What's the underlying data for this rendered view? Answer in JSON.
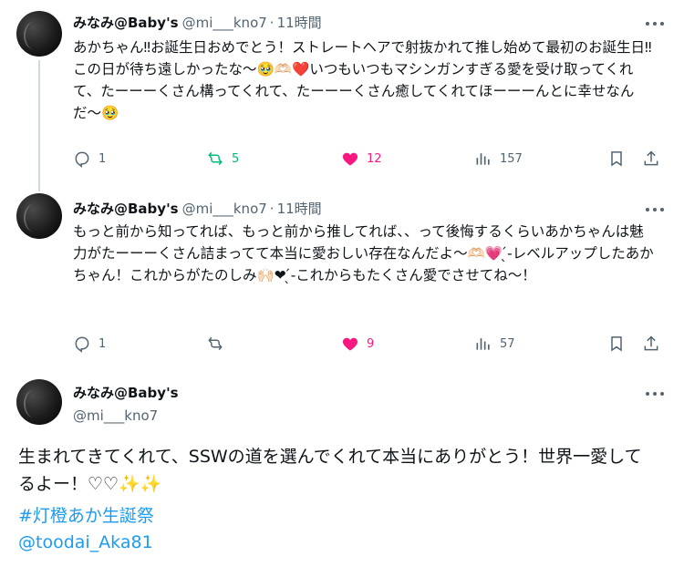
{
  "tweets": [
    {
      "name": "みなみ@Baby's",
      "handle": "@mi___kno7",
      "separator": "·",
      "time": "11時間",
      "text": "あかちゃん‼お誕生日おめでとう！ストレートヘアで射抜かれて推し始めて最初のお誕生日‼この日が待ち遠しかったな〜🥹🫶🏻❤️いつもいつもマシンガンすぎる愛を受け取ってくれて、たーーーくさん構ってくれて、たーーーくさん癒してくれてほーーーんとに幸せなんだ〜🥹",
      "replies": "1",
      "reposts": "5",
      "likes": "12",
      "views": "157"
    },
    {
      "name": "みなみ@Baby's",
      "handle": "@mi___kno7",
      "separator": "·",
      "time": "11時間",
      "text": "もっと前から知ってれば、もっと前から推してれば、、って後悔するくらいあかちゃんは魅力がたーーーくさん詰まってて本当に愛おしい存在なんだよ〜🫶🏻💗 ̖́-レベルアップしたあかちゃん！これからがたのしみ🙌🏻❤︎ ̖́-これからもたくさん愛でさせてね〜！",
      "replies": "1",
      "reposts": "",
      "likes": "9",
      "views": "57"
    }
  ],
  "main_tweet": {
    "name": "みなみ@Baby's",
    "handle": "@mi___kno7",
    "text": "生まれてきてくれて、SSWの道を選んでくれて本当にありがとう！世界一愛してるよー！♡♡✨✨",
    "hashtag": "#灯橙あか生誕祭",
    "mention": "@toodai_Aka81"
  },
  "colors": {
    "text": "#0f1419",
    "muted": "#536471",
    "repost": "#00ba7c",
    "like": "#f91880",
    "link": "#1d9bf0",
    "thread_line": "#cfd9de"
  },
  "icons": [
    "reply-icon",
    "repost-icon",
    "heart-icon",
    "views-icon",
    "bookmark-icon",
    "share-icon",
    "more-icon"
  ]
}
